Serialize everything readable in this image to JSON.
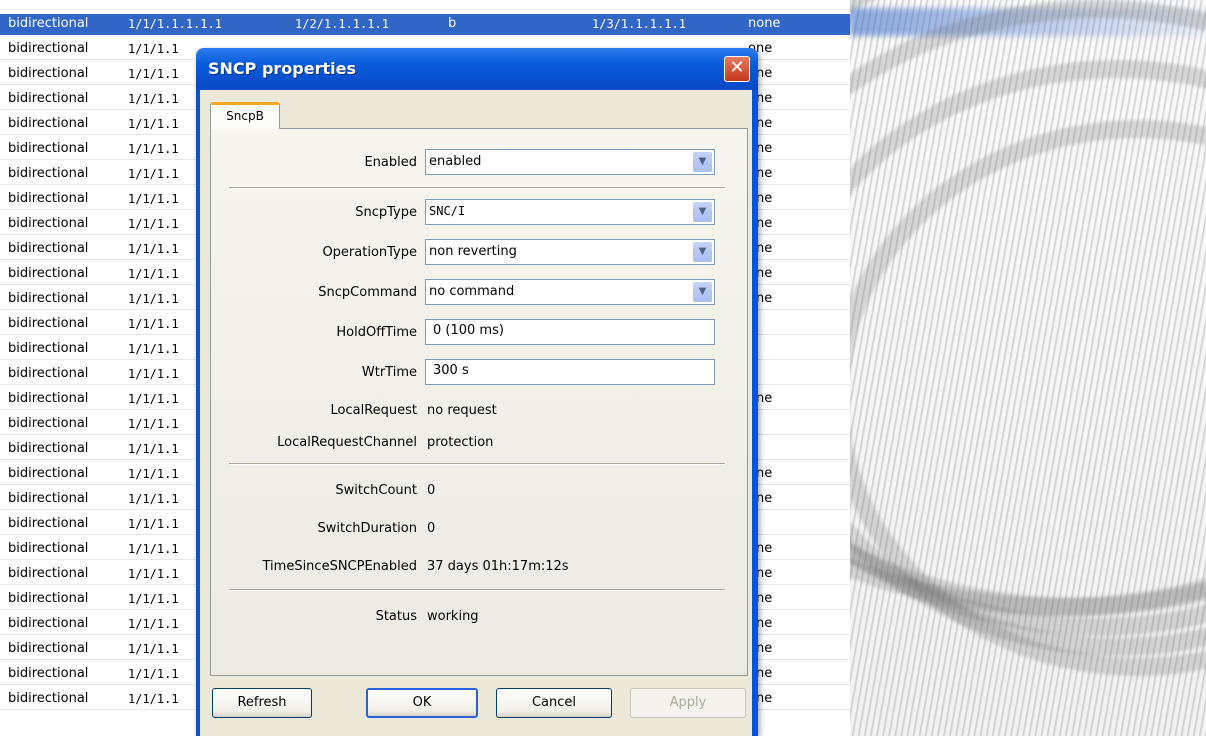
{
  "table": {
    "rows": [
      {
        "dir": "bidirectional",
        "a": "1/1/1.1.1.1.1",
        "b": "1/2/1.1.1.1.1",
        "c": "b",
        "d": "1/3/1.1.1.1.1",
        "e": "none",
        "selected": true
      },
      {
        "dir": "bidirectional",
        "a": "1/1/1.1",
        "e": "one"
      },
      {
        "dir": "bidirectional",
        "a": "1/1/1.1",
        "e": "one"
      },
      {
        "dir": "bidirectional",
        "a": "1/1/1.1",
        "e": "one"
      },
      {
        "dir": "bidirectional",
        "a": "1/1/1.1",
        "e": "one"
      },
      {
        "dir": "bidirectional",
        "a": "1/1/1.1",
        "e": "one"
      },
      {
        "dir": "bidirectional",
        "a": "1/1/1.1",
        "e": "one"
      },
      {
        "dir": "bidirectional",
        "a": "1/1/1.1",
        "e": "one"
      },
      {
        "dir": "bidirectional",
        "a": "1/1/1.1",
        "e": "one"
      },
      {
        "dir": "bidirectional",
        "a": "1/1/1.1",
        "e": "one"
      },
      {
        "dir": "bidirectional",
        "a": "1/1/1.1",
        "e": "one"
      },
      {
        "dir": "bidirectional",
        "a": "1/1/1.1",
        "e": "one"
      },
      {
        "dir": "bidirectional",
        "a": "1/1/1.1",
        "e": ""
      },
      {
        "dir": "bidirectional",
        "a": "1/1/1.1",
        "e": ""
      },
      {
        "dir": "bidirectional",
        "a": "1/1/1.1",
        "e": ""
      },
      {
        "dir": "bidirectional",
        "a": "1/1/1.1",
        "e": "one"
      },
      {
        "dir": "bidirectional",
        "a": "1/1/1.1",
        "e": ""
      },
      {
        "dir": "bidirectional",
        "a": "1/1/1.1",
        "e": ""
      },
      {
        "dir": "bidirectional",
        "a": "1/1/1.1",
        "e": "one"
      },
      {
        "dir": "bidirectional",
        "a": "1/1/1.1",
        "e": "one"
      },
      {
        "dir": "bidirectional",
        "a": "1/1/1.1",
        "e": ""
      },
      {
        "dir": "bidirectional",
        "a": "1/1/1.1",
        "e": "one"
      },
      {
        "dir": "bidirectional",
        "a": "1/1/1.1",
        "e": "one"
      },
      {
        "dir": "bidirectional",
        "a": "1/1/1.1",
        "e": "one"
      },
      {
        "dir": "bidirectional",
        "a": "1/1/1.1",
        "e": "one"
      },
      {
        "dir": "bidirectional",
        "a": "1/1/1.1",
        "e": "one"
      },
      {
        "dir": "bidirectional",
        "a": "1/1/1.1",
        "e": "one"
      },
      {
        "dir": "bidirectional",
        "a": "1/1/1.1",
        "e": "one"
      }
    ]
  },
  "dialog": {
    "title": "SNCP properties",
    "close_glyph": "✕",
    "tab_label": "SncpB",
    "fields": {
      "enabled": {
        "label": "Enabled",
        "value": "enabled"
      },
      "sncp_type": {
        "label": "SncpType",
        "value": "SNC/I"
      },
      "operation_type": {
        "label": "OperationType",
        "value": "non reverting"
      },
      "sncp_command": {
        "label": "SncpCommand",
        "value": "no command"
      },
      "hold_off_time": {
        "label": "HoldOffTime",
        "value": "0 (100 ms)"
      },
      "wtr_time": {
        "label": "WtrTime",
        "value": "300 s"
      },
      "local_request": {
        "label": "LocalRequest",
        "value": "no request"
      },
      "local_request_channel": {
        "label": "LocalRequestChannel",
        "value": "protection"
      },
      "switch_count": {
        "label": "SwitchCount",
        "value": "0"
      },
      "switch_duration": {
        "label": "SwitchDuration",
        "value": "0"
      },
      "time_since_enabled": {
        "label": "TimeSinceSNCPEnabled",
        "value": "37 days 01h:17m:12s"
      },
      "status": {
        "label": "Status",
        "value": "working"
      }
    },
    "buttons": {
      "refresh": "Refresh",
      "ok": "OK",
      "cancel": "Cancel",
      "apply": "Apply"
    }
  },
  "colors": {
    "selection": "#3166c6",
    "title_bar": "#0a5ddc",
    "dialog_face": "#ece9d8",
    "close_button": "#c2381d",
    "tab_highlight": "#f5a623"
  }
}
